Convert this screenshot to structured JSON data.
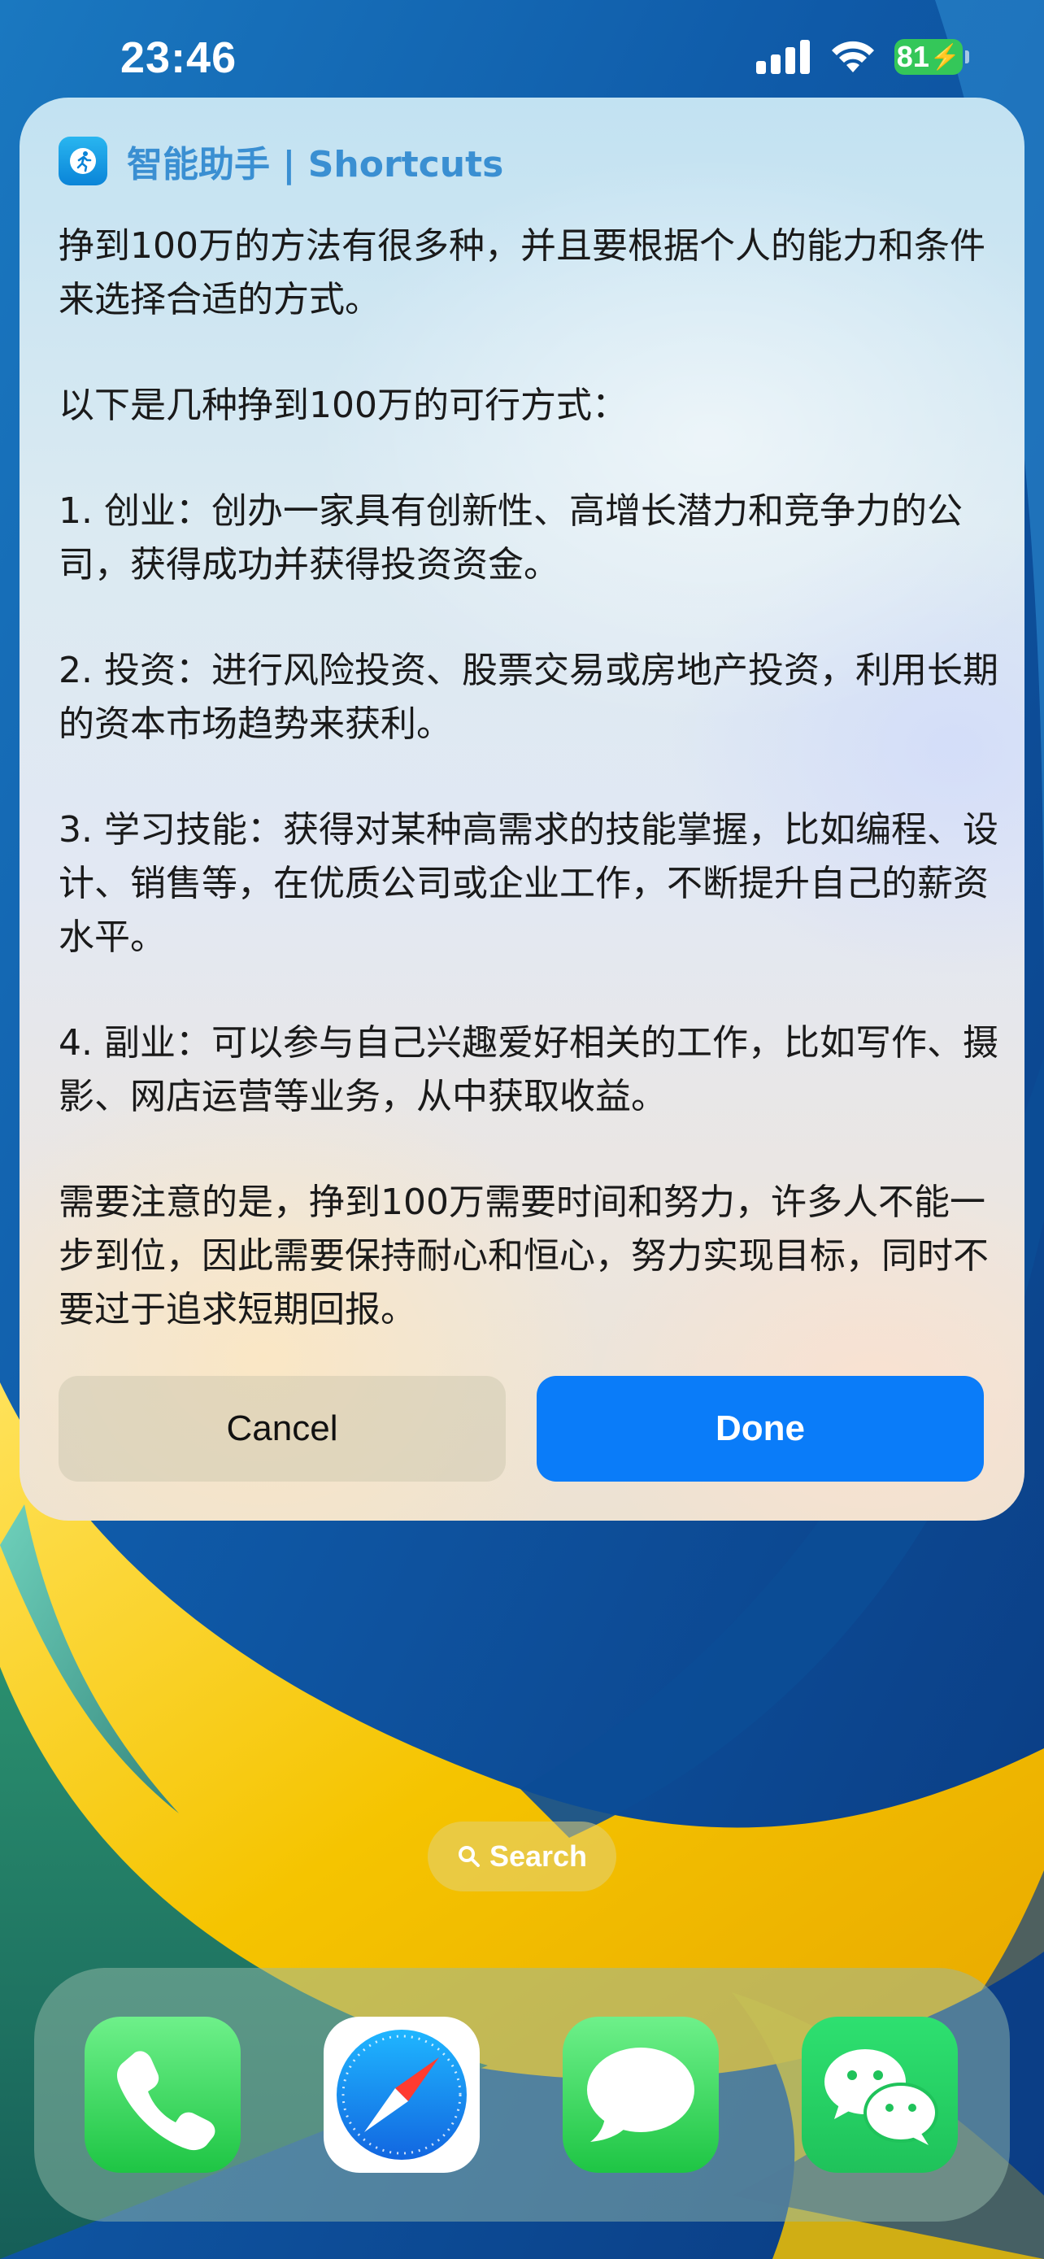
{
  "status_bar": {
    "time": "23:46",
    "battery": "81",
    "icons": [
      "cellular-signal-icon",
      "wifi-icon",
      "battery-charging-icon"
    ]
  },
  "shortcut_card": {
    "app_icon": "running-figure-icon",
    "title": "智能助手 | Shortcuts",
    "paragraphs": [
      "挣到100万的方法有很多种，并且要根据个人的能力和条件来选择合适的方式。",
      "以下是几种挣到100万的可行方式：",
      "1. 创业：创办一家具有创新性、高增长潜力和竞争力的公司，获得成功并获得投资资金。",
      "2. 投资：进行风险投资、股票交易或房地产投资，利用长期的资本市场趋势来获利。",
      "3. 学习技能：获得对某种高需求的技能掌握，比如编程、设计、销售等，在优质公司或企业工作，不断提升自己的薪资水平。",
      "4. 副业：可以参与自己兴趣爱好相关的工作，比如写作、摄影、网店运营等业务，从中获取收益。",
      "需要注意的是，挣到100万需要时间和努力，许多人不能一步到位，因此需要保持耐心和恒心，努力实现目标，同时不要过于追求短期回报。"
    ],
    "cancel_label": "Cancel",
    "done_label": "Done"
  },
  "home_screen": {
    "search_label": "Search",
    "dock_apps": [
      {
        "name": "Phone",
        "icon": "phone-icon"
      },
      {
        "name": "Safari",
        "icon": "compass-icon"
      },
      {
        "name": "Messages",
        "icon": "speech-bubble-icon"
      },
      {
        "name": "WeChat",
        "icon": "wechat-icon"
      }
    ]
  },
  "colors": {
    "done_button": "#0a7cf9",
    "battery": "#34c759",
    "title_text": "#3a8fd2"
  }
}
